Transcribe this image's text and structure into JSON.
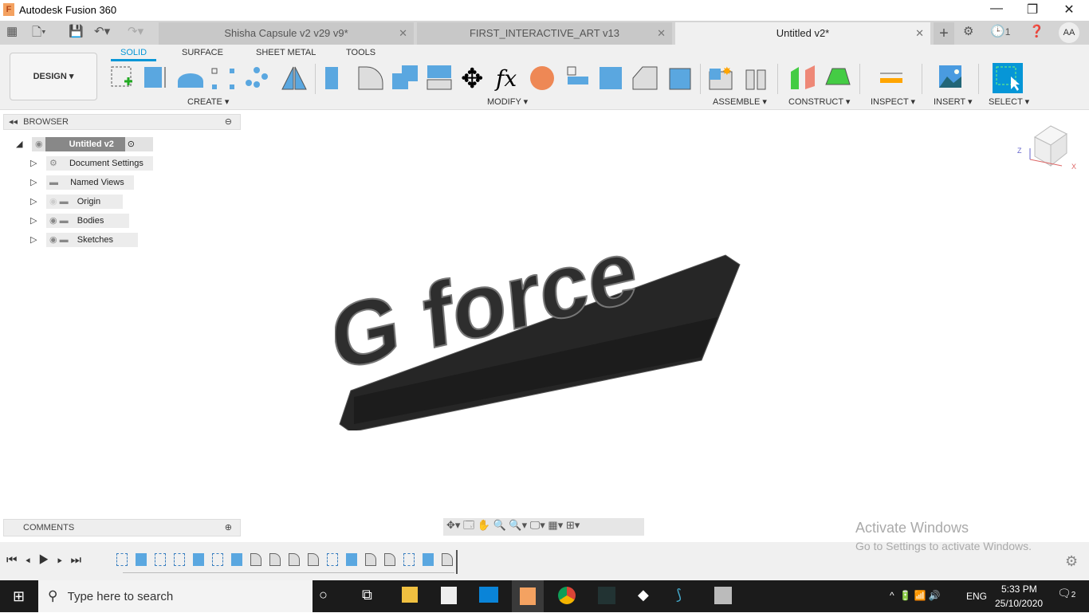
{
  "app": {
    "title": "Autodesk Fusion 360",
    "logo": "F"
  },
  "tabs": [
    {
      "label": "Shisha Capsule v2 v29 v9*"
    },
    {
      "label": "FIRST_INTERACTIVE_ART v13"
    },
    {
      "label": "Untitled v2*",
      "active": true
    }
  ],
  "header": {
    "job_count": "1",
    "user": "AA"
  },
  "workspace": {
    "label": "DESIGN ▾"
  },
  "toolbar_tabs": [
    "SOLID",
    "SURFACE",
    "SHEET METAL",
    "TOOLS"
  ],
  "groups": {
    "create": "CREATE ▾",
    "modify": "MODIFY ▾",
    "assemble": "ASSEMBLE ▾",
    "construct": "CONSTRUCT ▾",
    "inspect": "INSPECT ▾",
    "insert": "INSERT ▾",
    "select": "SELECT ▾"
  },
  "browser": {
    "title": "BROWSER",
    "root": "Untitled v2",
    "items": [
      "Document Settings",
      "Named Views",
      "Origin",
      "Bodies",
      "Sketches"
    ]
  },
  "comments": {
    "title": "COMMENTS"
  },
  "model_text": "G force",
  "watermark": {
    "line1": "Activate Windows",
    "line2": "Go to Settings to activate Windows."
  },
  "timeline": [
    "sketch",
    "extrude",
    "sketch",
    "sketch",
    "extrude",
    "sketch",
    "extrude",
    "fillet",
    "fillet",
    "fillet",
    "fillet",
    "sketch",
    "extrude",
    "fillet",
    "fillet",
    "sketch",
    "extrude",
    "fillet"
  ],
  "taskbar": {
    "search_placeholder": "Type here to search",
    "time": "5:33 PM",
    "date": "25/10/2020",
    "lang": "ENG",
    "notifications": "2"
  },
  "colors": {
    "accent": "#0696d7",
    "body": "#2b2b2b"
  }
}
